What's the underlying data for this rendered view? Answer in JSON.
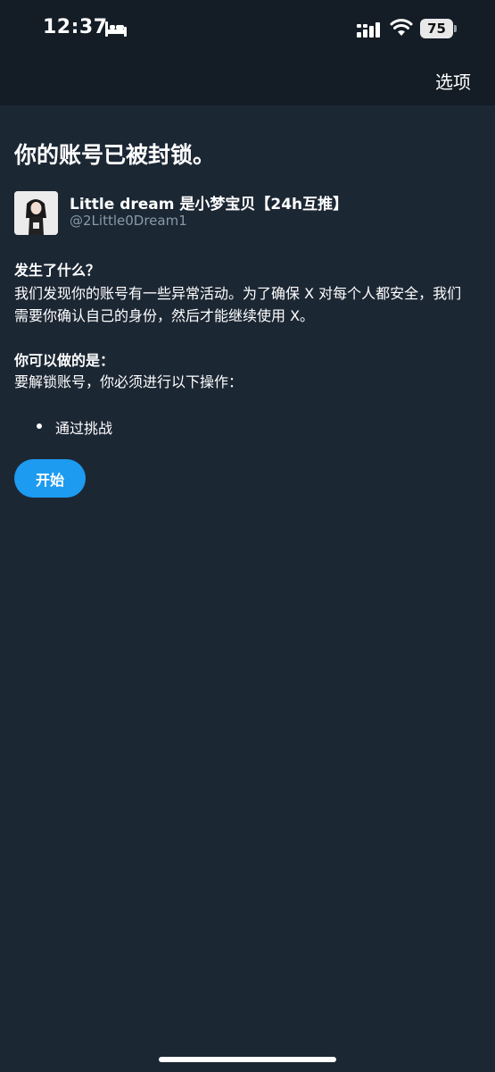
{
  "status_bar": {
    "time": "12:37",
    "battery": "75",
    "icons": [
      "bed-icon",
      "cellular-signal-icon",
      "wifi-icon",
      "battery-icon"
    ]
  },
  "nav": {
    "options_label": "选项"
  },
  "page": {
    "title": "你的账号已被封锁。"
  },
  "account": {
    "display_name": "Little dream 是小梦宝贝【24h互推】",
    "handle": "@2Little0Dream1"
  },
  "what_happened": {
    "heading": "发生了什么？",
    "body": "我们发现你的账号有一些异常活动。为了确保 X 对每个人都安全，我们需要你确认自己的身份，然后才能继续使用 X。"
  },
  "what_you_can_do": {
    "heading": "你可以做的是：",
    "body": "要解锁账号，你必须进行以下操作：",
    "steps": [
      "通过挑战"
    ]
  },
  "actions": {
    "start_label": "开始"
  },
  "colors": {
    "background": "#1c2734",
    "header_background": "#141d26",
    "accent": "#1d9bf0",
    "secondary_text": "#8899a6"
  }
}
